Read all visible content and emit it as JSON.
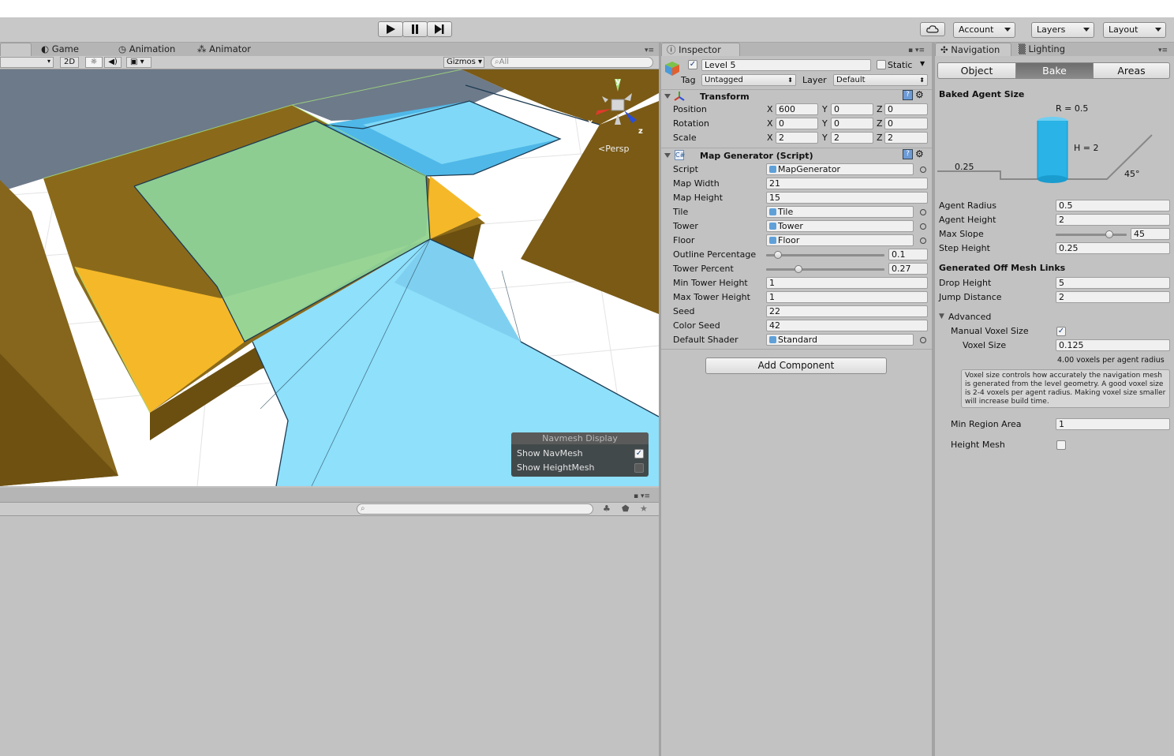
{
  "toolbar": {
    "play_icon": "play-icon",
    "pause_icon": "pause-icon",
    "step_icon": "step-icon",
    "cloud_icon": "cloud-icon",
    "account_label": "Account",
    "layers_label": "Layers",
    "layout_label": "Layout"
  },
  "scene_tabs": [
    {
      "label": "Game",
      "icon": "game-icon"
    },
    {
      "label": "Animation",
      "icon": "clock-icon"
    },
    {
      "label": "Animator",
      "icon": "animator-icon"
    }
  ],
  "scene_toolbar": {
    "mode_2d": "2D",
    "gizmos_label": "Gizmos",
    "search_placeholder": "All"
  },
  "scene": {
    "persp_label": "Persp",
    "axis_x": "x",
    "axis_y": "y",
    "axis_z": "z",
    "colors": {
      "sky": "#6d7a8a",
      "olive": "#7a5a15",
      "yellow": "#f5b829",
      "water": "#7fd8f7",
      "green": "#8ed8a0"
    }
  },
  "navmesh_display": {
    "title": "Navmesh Display",
    "show_navmesh_label": "Show NavMesh",
    "show_navmesh_checked": true,
    "show_heightmesh_label": "Show HeightMesh",
    "show_heightmesh_checked": false
  },
  "inspector": {
    "tab_label": "Inspector",
    "object_name": "Level 5",
    "active_checked": true,
    "static_label": "Static",
    "static_checked": false,
    "tag_label": "Tag",
    "tag_value": "Untagged",
    "layer_label": "Layer",
    "layer_value": "Default",
    "transform": {
      "title": "Transform",
      "position_label": "Position",
      "rotation_label": "Rotation",
      "scale_label": "Scale",
      "axis_x": "X",
      "axis_y": "Y",
      "axis_z": "Z",
      "position": [
        "600",
        "0",
        "0"
      ],
      "rotation": [
        "0",
        "0",
        "0"
      ],
      "scale": [
        "2",
        "2",
        "2"
      ]
    },
    "script": {
      "title": "Map Generator (Script)",
      "fields": [
        {
          "label": "Script",
          "value": "MapGenerator",
          "kind": "object"
        },
        {
          "label": "Map Width",
          "value": "21",
          "kind": "text"
        },
        {
          "label": "Map Height",
          "value": "15",
          "kind": "text"
        },
        {
          "label": "Tile",
          "value": "Tile",
          "kind": "object"
        },
        {
          "label": "Tower",
          "value": "Tower",
          "kind": "object"
        },
        {
          "label": "Floor",
          "value": "Floor",
          "kind": "object"
        },
        {
          "label": "Outline Percentage",
          "value": "0.1",
          "kind": "slider",
          "fraction": 0.1
        },
        {
          "label": "Tower Percent",
          "value": "0.27",
          "kind": "slider",
          "fraction": 0.27
        },
        {
          "label": "Min Tower Height",
          "value": "1",
          "kind": "text"
        },
        {
          "label": "Max Tower Height",
          "value": "1",
          "kind": "text"
        },
        {
          "label": "Seed",
          "value": "22",
          "kind": "text"
        },
        {
          "label": "Color Seed",
          "value": "42",
          "kind": "text"
        },
        {
          "label": "Default Shader",
          "value": "Standard",
          "kind": "object"
        }
      ]
    },
    "add_component_label": "Add Component"
  },
  "navigation": {
    "tabs": [
      {
        "label": "Navigation",
        "icon": "navigation-icon"
      },
      {
        "label": "Lighting",
        "icon": "lighting-icon"
      }
    ],
    "segments": [
      "Object",
      "Bake",
      "Areas"
    ],
    "active_segment": "Bake",
    "baked_agent_size_title": "Baked Agent Size",
    "diagram": {
      "radius_label": "R = 0.5",
      "height_label": "H = 2",
      "step_label": "0.25",
      "slope_label": "45°"
    },
    "agent_fields": [
      {
        "label": "Agent Radius",
        "value": "0.5"
      },
      {
        "label": "Agent Height",
        "value": "2"
      },
      {
        "label": "Max Slope",
        "value": "45",
        "kind": "slider",
        "fraction": 0.75
      },
      {
        "label": "Step Height",
        "value": "0.25"
      }
    ],
    "offmesh_title": "Generated Off Mesh Links",
    "offmesh_fields": [
      {
        "label": "Drop Height",
        "value": "5"
      },
      {
        "label": "Jump Distance",
        "value": "2"
      }
    ],
    "advanced_label": "Advanced",
    "manual_voxel_label": "Manual Voxel Size",
    "manual_voxel_checked": true,
    "voxel_size_label": "Voxel Size",
    "voxel_size_value": "0.125",
    "voxels_per_radius": "4.00 voxels per agent radius",
    "help_text": "Voxel size controls how accurately the navigation mesh is generated from the level geometry. A good voxel size is 2-4 voxels per agent radius. Making voxel size smaller will increase build time.",
    "min_region_label": "Min Region Area",
    "min_region_value": "1",
    "height_mesh_label": "Height Mesh",
    "height_mesh_checked": false
  }
}
